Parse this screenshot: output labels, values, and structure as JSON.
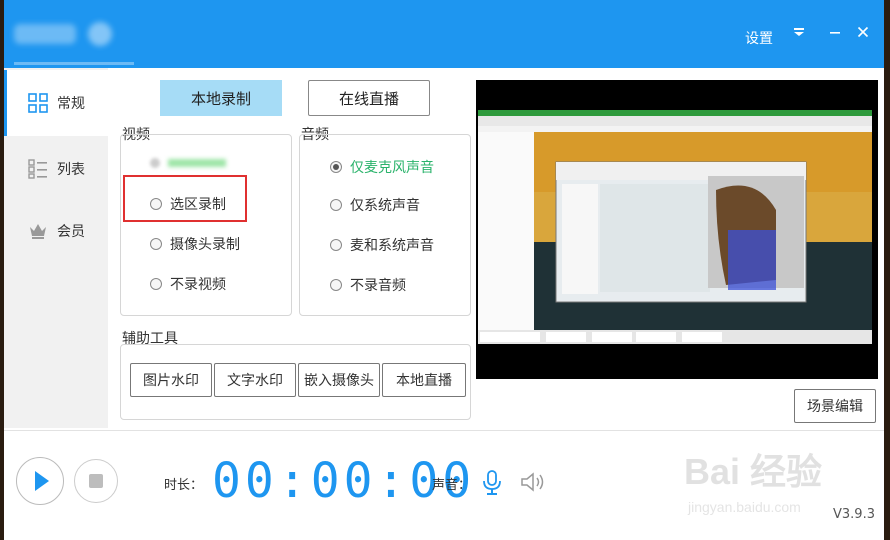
{
  "titlebar": {
    "settings_label": "设置",
    "menu_icon": "dropdown-menu-icon",
    "minimize_icon": "minimize-icon",
    "close_icon": "close-icon",
    "accent_color": "#1e96f0"
  },
  "sidebar": {
    "items": [
      {
        "label": "常规",
        "icon": "grid-icon",
        "active": true
      },
      {
        "label": "列表",
        "icon": "list-icon",
        "active": false
      },
      {
        "label": "会员",
        "icon": "crown-icon",
        "active": false
      }
    ]
  },
  "mode_tabs": {
    "local_record": "本地录制",
    "online_live": "在线直播"
  },
  "video": {
    "group_label": "视频",
    "options": [
      "选区录制",
      "摄像头录制",
      "不录视频"
    ]
  },
  "audio": {
    "group_label": "音频",
    "options": [
      "仅麦克风声音",
      "仅系统声音",
      "麦和系统声音",
      "不录音频"
    ],
    "selected": "仅麦克风声音",
    "selected_color": "#2ab36b"
  },
  "tools": {
    "group_label": "辅助工具",
    "buttons": [
      "图片水印",
      "文字水印",
      "嵌入摄像头",
      "本地直播"
    ]
  },
  "scene_edit": "场景编辑",
  "bottom": {
    "duration_label": "时长：",
    "timer": "00:00:00",
    "volume_label": "声音：",
    "mic_icon": "microphone-icon",
    "speaker_icon": "speaker-icon",
    "play_icon": "play-icon",
    "stop_icon": "stop-icon"
  },
  "version": "V3.9.3",
  "watermark": {
    "text": "Bai 经验",
    "url": "jingyan.baidu.com"
  }
}
